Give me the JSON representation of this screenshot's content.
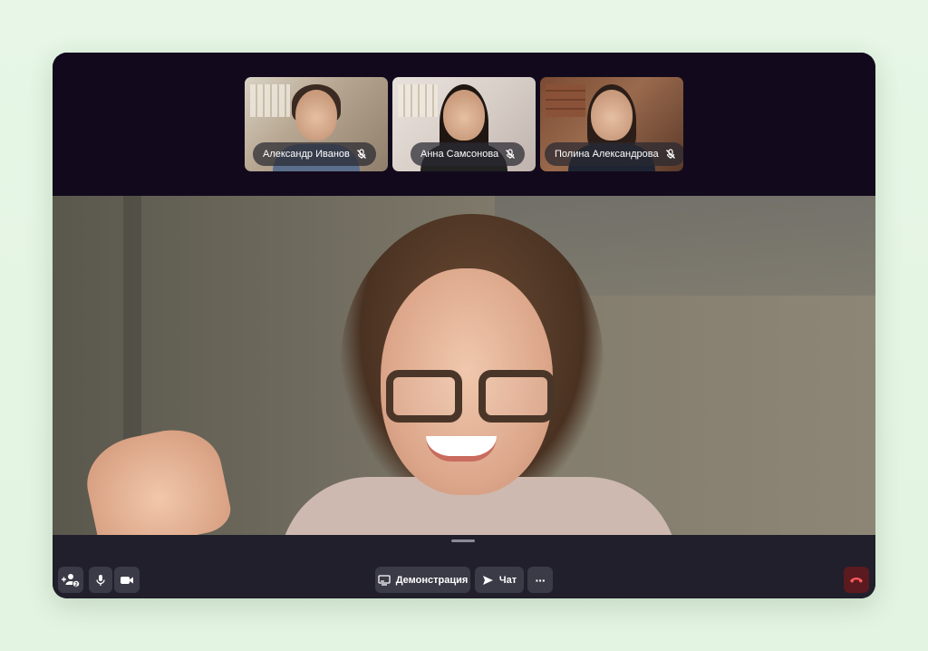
{
  "participants": [
    {
      "name": "Александр Иванов",
      "mic_icon": "mic-off-icon"
    },
    {
      "name": "Анна Самсонова",
      "mic_icon": "mic-off-icon"
    },
    {
      "name": "Полина Александрова",
      "mic_icon": "mic-off-icon"
    }
  ],
  "controls": {
    "add_user_badge": "2",
    "demo_label": "Демонстрация",
    "chat_label": "Чат",
    "more_label": "···"
  },
  "colors": {
    "page_background": "#e5f5e4",
    "window_background": "#17131f",
    "thumb_strip_background": "#120a1c",
    "control_bar_background": "#201f2b",
    "button_background": "#3b3a47",
    "hangup_background": "#5a1a1f",
    "hangup_icon": "#ff5a5a"
  }
}
